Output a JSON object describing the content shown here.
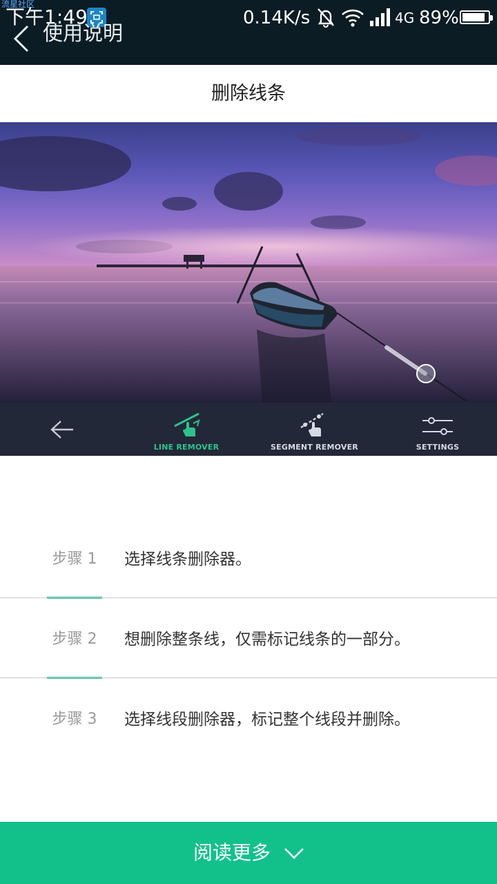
{
  "statusbar": {
    "watermark": "流星社区",
    "time": "下午1:49",
    "net_speed": "0.14K/s",
    "network_type": "4G",
    "battery_percent": "89%",
    "battery_level": 0.89
  },
  "navbar": {
    "title": "使用说明"
  },
  "page": {
    "title": "删除线条"
  },
  "toolbar": {
    "items": [
      {
        "label": "",
        "icon": "back-arrow-icon"
      },
      {
        "label": "LINE REMOVER",
        "icon": "line-remover-icon"
      },
      {
        "label": "SEGMENT REMOVER",
        "icon": "segment-remover-icon"
      },
      {
        "label": "SETTINGS",
        "icon": "settings-sliders-icon"
      }
    ]
  },
  "steps": [
    {
      "label": "步骤 1",
      "text": "选择线条删除器。"
    },
    {
      "label": "步骤 2",
      "text": "想删除整条线，仅需标记线条的一部分。"
    },
    {
      "label": "步骤 3",
      "text": "选择线段删除器，标记整个线段并删除。"
    }
  ],
  "footer": {
    "read_more_label": "阅读更多"
  },
  "colors": {
    "accent": "#12c18a",
    "header_bg": "#0b1c24",
    "toolbar_bg": "#232838"
  }
}
